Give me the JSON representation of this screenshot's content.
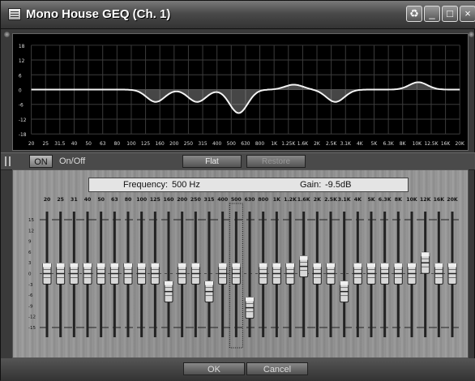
{
  "window": {
    "title": "Mono House GEQ (Ch. 1)"
  },
  "title_buttons": {
    "refresh": "♻",
    "minimize": "_",
    "maximize": "□",
    "close": "×"
  },
  "graph": {
    "y_ticks": [
      "18",
      "12",
      "6",
      "0",
      "-6",
      "-12",
      "-18"
    ],
    "x_ticks": [
      "20",
      "25",
      "31.5",
      "40",
      "50",
      "63",
      "80",
      "100",
      "125",
      "160",
      "200",
      "250",
      "315",
      "400",
      "500",
      "630",
      "800",
      "1K",
      "1.25K",
      "1.6K",
      "2K",
      "2.5K",
      "3.1K",
      "4K",
      "5K",
      "6.3K",
      "8K",
      "10K",
      "12.5K",
      "16K",
      "20K"
    ]
  },
  "controls": {
    "on_label": "ON",
    "onoff_label": "On/Off",
    "flat_label": "Flat",
    "restore_label": "Restore"
  },
  "readout": {
    "frequency_label": "Frequency:",
    "frequency_value": "500 Hz",
    "gain_label": "Gain:",
    "gain_value": "-9.5dB"
  },
  "faders": {
    "scale": [
      "15",
      "12",
      "9",
      "6",
      "3",
      "0",
      "-3",
      "-6",
      "-9",
      "-12",
      "-15"
    ],
    "bands": [
      "20",
      "25",
      "31",
      "40",
      "50",
      "63",
      "80",
      "100",
      "125",
      "160",
      "200",
      "250",
      "315",
      "400",
      "500",
      "630",
      "800",
      "1K",
      "1.2K",
      "1.6K",
      "2K",
      "2.5K",
      "3.1K",
      "4K",
      "5K",
      "6.3K",
      "8K",
      "10K",
      "12K",
      "16K",
      "20K"
    ],
    "gains_db": [
      0,
      0,
      0,
      0,
      0,
      0,
      0,
      0,
      0,
      -5,
      0,
      0,
      -5,
      0,
      0,
      -9.5,
      0,
      0,
      0,
      2,
      0,
      0,
      -5,
      0,
      0,
      0,
      0,
      0,
      3,
      0,
      0,
      0
    ],
    "selected_index": 14
  },
  "footer": {
    "ok_label": "OK",
    "cancel_label": "Cancel"
  }
}
